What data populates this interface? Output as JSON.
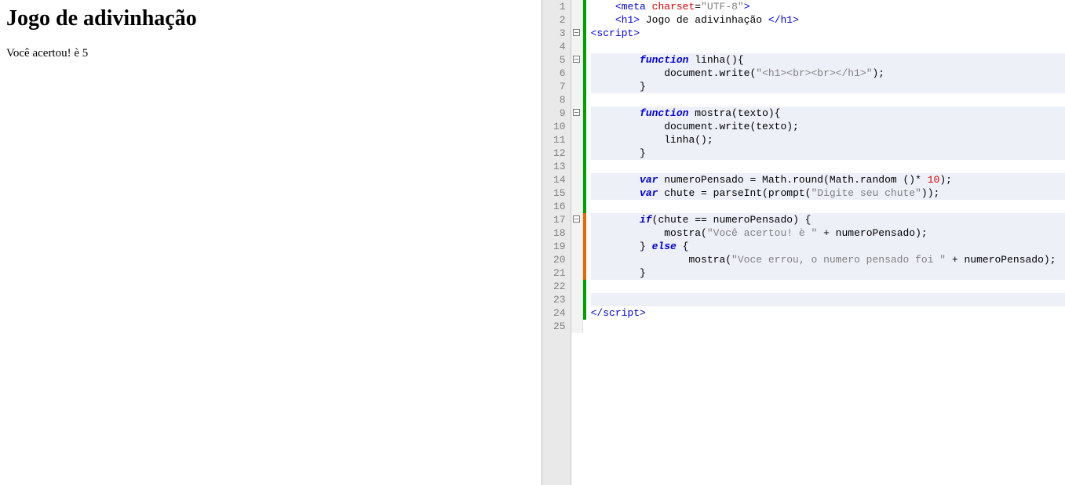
{
  "preview": {
    "title": "Jogo de adivinhação",
    "message": "Você acertou! è 5"
  },
  "editor": {
    "line_count": 25,
    "fold_lines": [
      3,
      5,
      9,
      17
    ],
    "change_bars": [
      {
        "from": 1,
        "to": 16,
        "kind": "saved"
      },
      {
        "from": 17,
        "to": 21,
        "kind": "mod"
      },
      {
        "from": 22,
        "to": 24,
        "kind": "saved"
      }
    ],
    "highlight_ranges": [
      [
        5,
        7
      ],
      [
        9,
        12
      ],
      [
        14,
        15
      ],
      [
        17,
        21
      ],
      [
        23,
        23
      ]
    ],
    "code_lines": [
      {
        "n": 1,
        "indent": 1,
        "tokens": [
          {
            "t": "<",
            "c": "tk-tag"
          },
          {
            "t": "meta",
            "c": "tk-tag"
          },
          {
            "t": " ",
            "c": ""
          },
          {
            "t": "charset",
            "c": "tk-attr"
          },
          {
            "t": "=",
            "c": "tk-punct"
          },
          {
            "t": "\"UTF-8\"",
            "c": "tk-str"
          },
          {
            "t": ">",
            "c": "tk-tag"
          }
        ]
      },
      {
        "n": 2,
        "indent": 1,
        "tokens": [
          {
            "t": "<",
            "c": "tk-tag"
          },
          {
            "t": "h1",
            "c": "tk-tag"
          },
          {
            "t": ">",
            "c": "tk-tag"
          },
          {
            "t": " Jogo de adivinhação ",
            "c": "tk-txt"
          },
          {
            "t": "<",
            "c": "tk-tag"
          },
          {
            "t": "/h1",
            "c": "tk-tag"
          },
          {
            "t": ">",
            "c": "tk-tag"
          }
        ]
      },
      {
        "n": 3,
        "indent": 0,
        "tokens": [
          {
            "t": "<",
            "c": "tk-tag"
          },
          {
            "t": "script",
            "c": "tk-tag"
          },
          {
            "t": ">",
            "c": "tk-tag"
          }
        ]
      },
      {
        "n": 4,
        "indent": 0,
        "tokens": []
      },
      {
        "n": 5,
        "indent": 2,
        "tokens": [
          {
            "t": "function",
            "c": "tk-kw"
          },
          {
            "t": " linha(){",
            "c": "tk-fn"
          }
        ]
      },
      {
        "n": 6,
        "indent": 3,
        "tokens": [
          {
            "t": "document.write(",
            "c": "tk-fn"
          },
          {
            "t": "\"<h1><br><br></h1>\"",
            "c": "tk-str"
          },
          {
            "t": ");",
            "c": "tk-fn"
          }
        ]
      },
      {
        "n": 7,
        "indent": 2,
        "tokens": [
          {
            "t": "}",
            "c": "tk-fn"
          }
        ]
      },
      {
        "n": 8,
        "indent": 0,
        "tokens": []
      },
      {
        "n": 9,
        "indent": 2,
        "tokens": [
          {
            "t": "function",
            "c": "tk-kw"
          },
          {
            "t": " mostra(texto){",
            "c": "tk-fn"
          }
        ]
      },
      {
        "n": 10,
        "indent": 3,
        "tokens": [
          {
            "t": "document.write(texto);",
            "c": "tk-fn"
          }
        ]
      },
      {
        "n": 11,
        "indent": 3,
        "tokens": [
          {
            "t": "linha();",
            "c": "tk-fn"
          }
        ]
      },
      {
        "n": 12,
        "indent": 2,
        "tokens": [
          {
            "t": "}",
            "c": "tk-fn"
          }
        ]
      },
      {
        "n": 13,
        "indent": 0,
        "tokens": []
      },
      {
        "n": 14,
        "indent": 2,
        "tokens": [
          {
            "t": "var",
            "c": "tk-kw"
          },
          {
            "t": " numeroPensado = Math.round(Math.random ()* ",
            "c": "tk-fn"
          },
          {
            "t": "10",
            "c": "tk-num"
          },
          {
            "t": ");",
            "c": "tk-fn"
          }
        ]
      },
      {
        "n": 15,
        "indent": 2,
        "tokens": [
          {
            "t": "var",
            "c": "tk-kw"
          },
          {
            "t": " chute = parseInt(prompt(",
            "c": "tk-fn"
          },
          {
            "t": "\"Digite seu chute\"",
            "c": "tk-str"
          },
          {
            "t": "));",
            "c": "tk-fn"
          }
        ]
      },
      {
        "n": 16,
        "indent": 0,
        "tokens": []
      },
      {
        "n": 17,
        "indent": 2,
        "tokens": [
          {
            "t": "if",
            "c": "tk-kw"
          },
          {
            "t": "(chute == numeroPensado) {",
            "c": "tk-fn"
          }
        ]
      },
      {
        "n": 18,
        "indent": 3,
        "tokens": [
          {
            "t": "mostra(",
            "c": "tk-fn"
          },
          {
            "t": "\"Você acertou! è \"",
            "c": "tk-str"
          },
          {
            "t": " + numeroPensado);",
            "c": "tk-fn"
          }
        ]
      },
      {
        "n": 19,
        "indent": 2,
        "tokens": [
          {
            "t": "} ",
            "c": "tk-fn"
          },
          {
            "t": "else",
            "c": "tk-kw"
          },
          {
            "t": " {",
            "c": "tk-fn"
          }
        ]
      },
      {
        "n": 20,
        "indent": 4,
        "tokens": [
          {
            "t": "mostra(",
            "c": "tk-fn"
          },
          {
            "t": "\"Voce errou, o numero pensado foi \"",
            "c": "tk-str"
          },
          {
            "t": " + numeroPensado);",
            "c": "tk-fn"
          }
        ]
      },
      {
        "n": 21,
        "indent": 2,
        "tokens": [
          {
            "t": "}",
            "c": "tk-fn"
          }
        ]
      },
      {
        "n": 22,
        "indent": 0,
        "tokens": []
      },
      {
        "n": 23,
        "indent": 0,
        "tokens": []
      },
      {
        "n": 24,
        "indent": 0,
        "tokens": [
          {
            "t": "<",
            "c": "tk-tag"
          },
          {
            "t": "/script",
            "c": "tk-tag"
          },
          {
            "t": ">",
            "c": "tk-tag"
          }
        ]
      },
      {
        "n": 25,
        "indent": 0,
        "tokens": []
      }
    ]
  }
}
